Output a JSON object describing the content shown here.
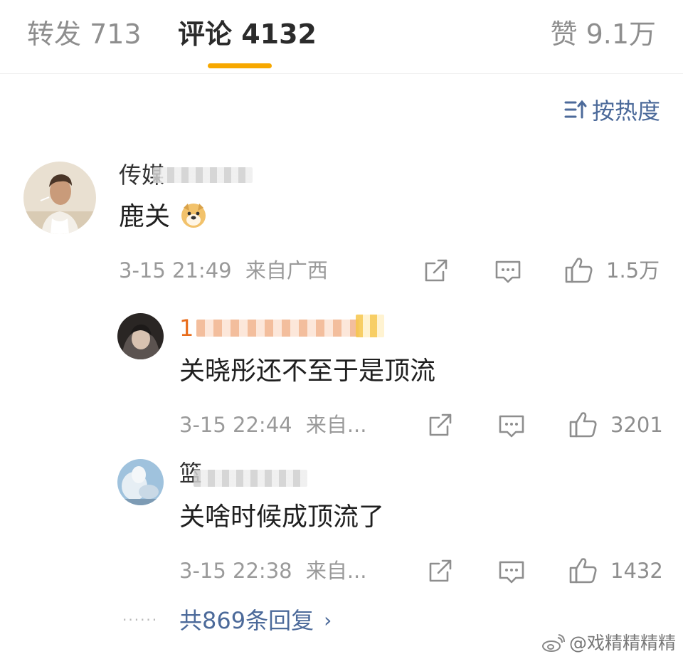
{
  "tabs": {
    "repost": "转发 713",
    "comments": "评论 4132",
    "likes": "赞 9.1万"
  },
  "sort": {
    "label": "按热度",
    "icon": "sort-icon"
  },
  "comments": [
    {
      "user": "传媒",
      "content": "鹿关",
      "emoji": "doge-emoji",
      "time": "3-15 21:49",
      "location": "来自广西",
      "likes": "1.5万"
    }
  ],
  "replies": [
    {
      "user": "1",
      "content": "关晓彤还不至于是顶流",
      "time": "3-15 22:44",
      "location": "来自...",
      "likes": "3201"
    },
    {
      "user": "篮",
      "content": "关啥时候成顶流了",
      "time": "3-15 22:38",
      "location": "来自...",
      "likes": "1432"
    }
  ],
  "more": {
    "dots": "······",
    "label": "共869条回复",
    "chevron": "›"
  },
  "watermark": {
    "text": "@戏精精精精"
  },
  "colors": {
    "accent": "#f7a800",
    "link": "#4c6a9a",
    "name_orange": "#e86c1b",
    "muted": "#9a9a9a"
  }
}
